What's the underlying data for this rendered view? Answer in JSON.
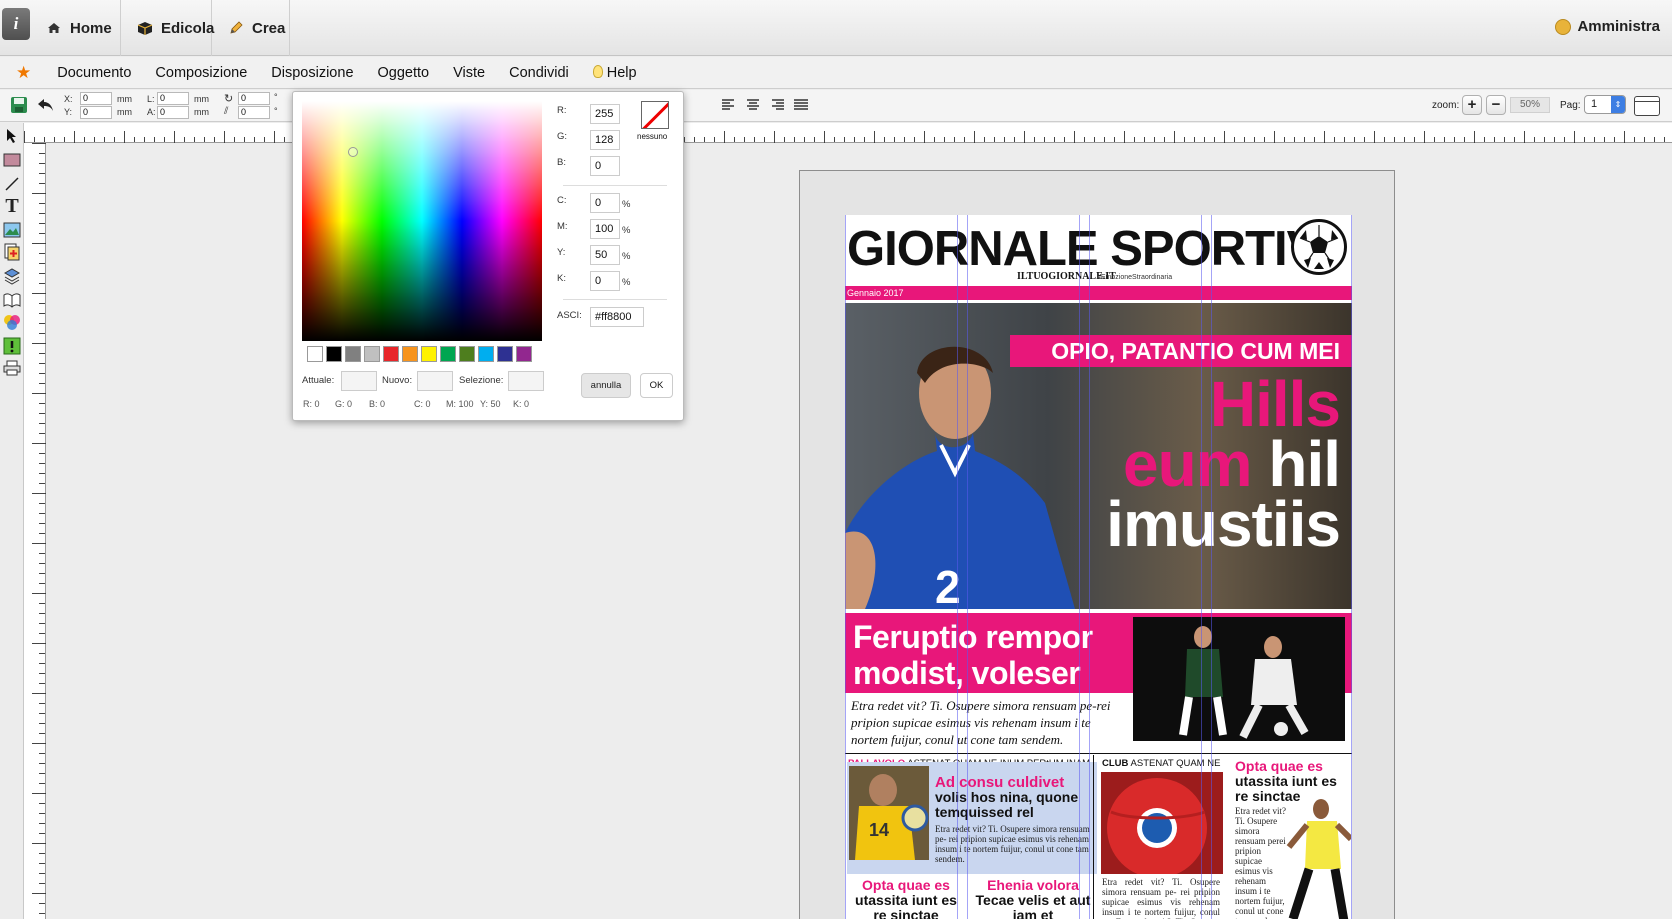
{
  "nav": {
    "info": "i",
    "tabs": [
      {
        "label": "Home",
        "icon": "home-icon"
      },
      {
        "label": "Edicola",
        "icon": "box-icon"
      },
      {
        "label": "Crea",
        "icon": "pencil-icon"
      }
    ],
    "user": "Amministra"
  },
  "menu": {
    "items": [
      "Documento",
      "Composizione",
      "Disposizione",
      "Oggetto",
      "Viste",
      "Condividi",
      "Help"
    ]
  },
  "toolbar": {
    "x_label": "X:",
    "x_value": "0",
    "y_label": "Y:",
    "y_value": "0",
    "unit": "mm",
    "l_label": "L:",
    "l_value": "0",
    "a_label": "A:",
    "a_value": "0",
    "rot_value": "0",
    "skew_value": "0",
    "deg": "°",
    "zoom_label": "zoom:",
    "zoom_in": "+",
    "zoom_out": "−",
    "zoom_value": "50%",
    "page_label": "Pag:",
    "page_value": "1"
  },
  "picker": {
    "r_label": "R:",
    "r": "255",
    "g_label": "G:",
    "g": "128",
    "b_label": "B:",
    "b": "0",
    "c_label": "C:",
    "c": "0",
    "m_label": "M:",
    "m": "100",
    "y_label": "Y:",
    "y": "50",
    "k_label": "K:",
    "k": "0",
    "pct": "%",
    "none_label": "nessuno",
    "asci_label": "ASCI:",
    "asci": "#ff8800",
    "current_label": "Attuale:",
    "new_label": "Nuovo:",
    "selection_label": "Selezione:",
    "cancel": "annulla",
    "ok": "OK",
    "readout": {
      "r": "R: 0",
      "g": "G: 0",
      "b": "B: 0",
      "c": "C: 0",
      "m": "M: 100",
      "y": "Y: 50",
      "k": "K: 0"
    },
    "swatches": [
      "#ffffff",
      "#000000",
      "#808080",
      "#c0c0c0",
      "#e8262a",
      "#f7941d",
      "#fff200",
      "#00a651",
      "#4e7e1e",
      "#00aeef",
      "#2e3192",
      "#92278f"
    ]
  },
  "newspaper": {
    "title": "GIORNALE SPORTIV",
    "site": "ILTUOGIORNALE.IT",
    "hashtag": "#EmozioneStraordinaria",
    "date": "Gennaio 2017",
    "hero_band": "OPIO, PATANTIO CUM MEI",
    "hero_line1": "Hills",
    "hero_line2a": "eum",
    "hero_line2b": "hil",
    "hero_line3": "imustiis",
    "feature_title1": "Feruptio rempor",
    "feature_title2": "modist, voleser",
    "feature_text": "Etra redet vit? Ti. Osupere simora rensuam pe-rei pripion supicae esimus vis rehenam insum i te nortem fuijur, conul ut cone tam sendem.",
    "col1_tag": "PALLAVOLO",
    "col1_head": "ASTENAT QUAM NE INUM PERtUM INAM",
    "col1_pink": "Ad consu culdivet",
    "col1_sub": "volis hos nina, quone temquissed rel",
    "col1_text": "Etra redet vit? Ti. Osupere simora rensuam pe- rei pripion supicae esimus vis rehenam insum i te nortem fuijur, conul ut cone tam sendem.",
    "col1b_pink": "Opta quae es",
    "col1b_text": "utassita iunt es re sinctae",
    "col2b_pink": "Ehenia volora",
    "col2b_text": "Tecae velis et aut iam et",
    "col3_tag": "CLUB",
    "col3_head": "ASTENAT QUAM NE",
    "col3_text": "Etra redet vit? Ti. Osupere simora rensuam pe- rei pripion supicae esimus vis rehenam insum i te nortem fuijur, conul ut. Etra redet vit? Ti. Osupere simora rensuam pe- rei pripion",
    "col4_pink": "Opta quae es",
    "col4_sub": "utassita iunt es re sinctae",
    "col4_text": "Etra redet vit? Ti. Osupere simora rensuam perei pripion supicae esimus vis rehenam insum i te nortem fuijur, conul ut cone tam sendem."
  }
}
